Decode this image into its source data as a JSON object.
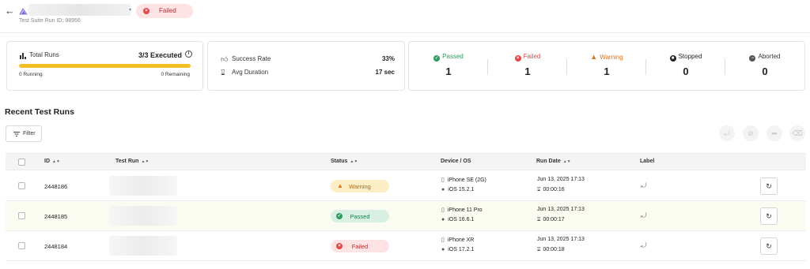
{
  "header": {
    "status_label": "Failed",
    "run_id_text": "Test Suite Run ID: 98956"
  },
  "summary": {
    "total_runs_label": "Total Runs",
    "executed_text": "3/3 Executed",
    "progress_fraction": 1.0,
    "running_text": "0 Running",
    "remaining_text": "0 Remaining",
    "success_rate_label": "Success Rate",
    "success_rate_value": "33%",
    "avg_duration_label": "Avg Duration",
    "avg_duration_value": "17 sec"
  },
  "stats": [
    {
      "label": "Passed",
      "value": "1",
      "color": "#2e9b5f",
      "icon": "check-circle-icon"
    },
    {
      "label": "Failed",
      "value": "1",
      "color": "#e24848",
      "icon": "x-circle-icon"
    },
    {
      "label": "Warning",
      "value": "1",
      "color": "#d8741d",
      "icon": "warning-triangle-icon"
    },
    {
      "label": "Stopped",
      "value": "0",
      "color": "#222222",
      "icon": "stop-circle-icon"
    },
    {
      "label": "Aborted",
      "value": "0",
      "color": "#555555",
      "icon": "minus-circle-icon"
    }
  ],
  "section": {
    "title": "Recent Test Runs",
    "filter_label": "Filter"
  },
  "table": {
    "headers": {
      "id": "ID",
      "test_run": "Test Run",
      "status": "Status",
      "device_os": "Device / OS",
      "run_date": "Run Date",
      "label": "Label"
    },
    "rows": [
      {
        "id": "2448186",
        "status": "Warning",
        "device": "iPhone SE (2G)",
        "os": "iOS 15.2.1",
        "date": "Jun 13, 2025 17:13",
        "duration": "00:00:16"
      },
      {
        "id": "2448185",
        "status": "Passed",
        "device": "iPhone 11 Pro",
        "os": "iOS 16.6.1",
        "date": "Jun 13, 2025 17:13",
        "duration": "00:00:17"
      },
      {
        "id": "2448184",
        "status": "Failed",
        "device": "iPhone XR",
        "os": "iOS 17.2.1",
        "date": "Jun 13, 2025 17:13",
        "duration": "00:00:18"
      }
    ]
  },
  "colors": {
    "accent_yellow": "#f4bf25",
    "warning_bg": "#fbedc4",
    "warning_text": "#b66a12",
    "passed_bg": "#d8f0e3",
    "passed_text": "#1f7a48",
    "failed_bg": "#fde3e3",
    "failed_text": "#c0282d"
  }
}
